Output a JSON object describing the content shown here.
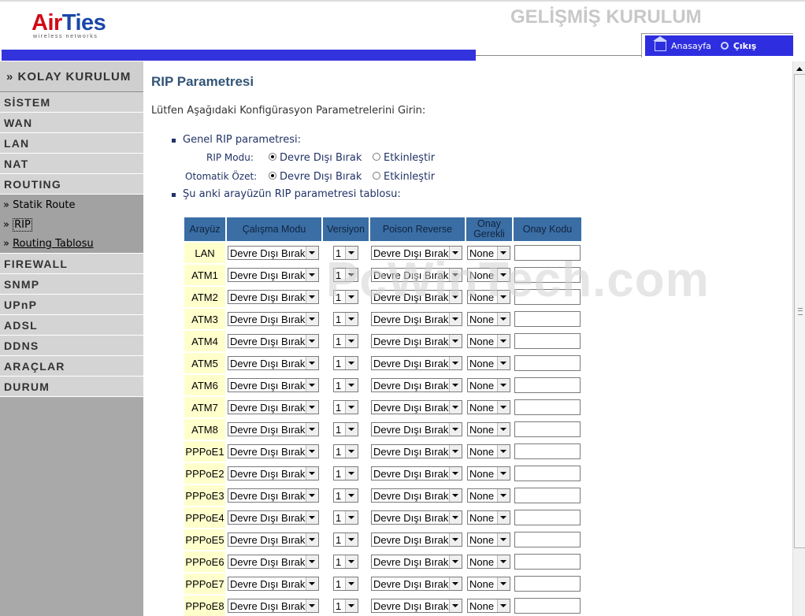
{
  "header": {
    "logo_brand_a": "Air",
    "logo_brand_b": "Ties",
    "logo_sub": "wireless networks",
    "title": "GELİŞMİŞ KURULUM",
    "home_label": "Anasayfa",
    "exit_label": "Çıkış"
  },
  "sidebar": {
    "kolay": "» KOLAY KURULUM",
    "items_top": [
      "SİSTEM",
      "WAN",
      "LAN",
      "NAT",
      "ROUTING"
    ],
    "sub_items": [
      "Statik Route",
      "RIP",
      "Routing Tablosu"
    ],
    "items_bottom": [
      "FIREWALL",
      "SNMP",
      "UPnP",
      "ADSL",
      "DDNS",
      "ARAÇLAR",
      "DURUM"
    ]
  },
  "main": {
    "title": "RIP Parametresi",
    "intro": "Lütfen Aşağıdaki Konfigürasyon Parametrelerini Girin:",
    "section_general": "Genel RIP parametresi:",
    "rip_mode_label": "RIP Modu:",
    "auto_summary_label": "Otomatik Özet:",
    "opt_disable": "Devre Dışı Bırak",
    "opt_enable": "Etkinleştir",
    "rip_mode_value": "disable",
    "auto_summary_value": "disable",
    "section_table": "Şu anki arayüzün RIP parametresi tablosu:",
    "watermark": "PcWinTech.com"
  },
  "table": {
    "headers": [
      "Arayüz",
      "Çalışma Modu",
      "Versiyon",
      "Poison Reverse",
      "Onay Gerekli",
      "Onay Kodu"
    ],
    "rows": [
      {
        "iface": "LAN",
        "mode": "Devre Dışı Bırak",
        "version": "1",
        "poison": "Devre Dışı Bırak",
        "auth": "None",
        "code": ""
      },
      {
        "iface": "ATM1",
        "mode": "Devre Dışı Bırak",
        "version": "1",
        "poison": "Devre Dışı Bırak",
        "auth": "None",
        "code": ""
      },
      {
        "iface": "ATM2",
        "mode": "Devre Dışı Bırak",
        "version": "1",
        "poison": "Devre Dışı Bırak",
        "auth": "None",
        "code": ""
      },
      {
        "iface": "ATM3",
        "mode": "Devre Dışı Bırak",
        "version": "1",
        "poison": "Devre Dışı Bırak",
        "auth": "None",
        "code": ""
      },
      {
        "iface": "ATM4",
        "mode": "Devre Dışı Bırak",
        "version": "1",
        "poison": "Devre Dışı Bırak",
        "auth": "None",
        "code": ""
      },
      {
        "iface": "ATM5",
        "mode": "Devre Dışı Bırak",
        "version": "1",
        "poison": "Devre Dışı Bırak",
        "auth": "None",
        "code": ""
      },
      {
        "iface": "ATM6",
        "mode": "Devre Dışı Bırak",
        "version": "1",
        "poison": "Devre Dışı Bırak",
        "auth": "None",
        "code": ""
      },
      {
        "iface": "ATM7",
        "mode": "Devre Dışı Bırak",
        "version": "1",
        "poison": "Devre Dışı Bırak",
        "auth": "None",
        "code": ""
      },
      {
        "iface": "ATM8",
        "mode": "Devre Dışı Bırak",
        "version": "1",
        "poison": "Devre Dışı Bırak",
        "auth": "None",
        "code": ""
      },
      {
        "iface": "PPPoE1",
        "mode": "Devre Dışı Bırak",
        "version": "1",
        "poison": "Devre Dışı Bırak",
        "auth": "None",
        "code": ""
      },
      {
        "iface": "PPPoE2",
        "mode": "Devre Dışı Bırak",
        "version": "1",
        "poison": "Devre Dışı Bırak",
        "auth": "None",
        "code": ""
      },
      {
        "iface": "PPPoE3",
        "mode": "Devre Dışı Bırak",
        "version": "1",
        "poison": "Devre Dışı Bırak",
        "auth": "None",
        "code": ""
      },
      {
        "iface": "PPPoE4",
        "mode": "Devre Dışı Bırak",
        "version": "1",
        "poison": "Devre Dışı Bırak",
        "auth": "None",
        "code": ""
      },
      {
        "iface": "PPPoE5",
        "mode": "Devre Dışı Bırak",
        "version": "1",
        "poison": "Devre Dışı Bırak",
        "auth": "None",
        "code": ""
      },
      {
        "iface": "PPPoE6",
        "mode": "Devre Dışı Bırak",
        "version": "1",
        "poison": "Devre Dışı Bırak",
        "auth": "None",
        "code": ""
      },
      {
        "iface": "PPPoE7",
        "mode": "Devre Dışı Bırak",
        "version": "1",
        "poison": "Devre Dışı Bırak",
        "auth": "None",
        "code": ""
      },
      {
        "iface": "PPPoE8",
        "mode": "Devre Dışı Bırak",
        "version": "1",
        "poison": "Devre Dışı Bırak",
        "auth": "None",
        "code": ""
      }
    ]
  },
  "colors": {
    "accent_blue": "#3333dd",
    "table_header": "#3a6ea5",
    "iface_cell": "#ffffcc",
    "sidebar": "#a9a9a9",
    "title_text": "#335577"
  }
}
